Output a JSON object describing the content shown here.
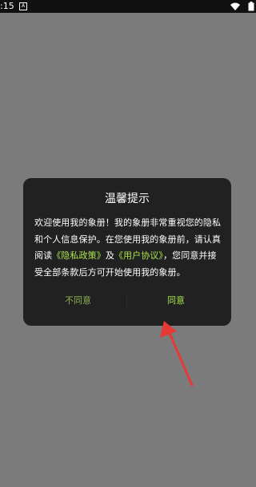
{
  "status_bar": {
    "time": ":15",
    "notification_glyph": "A",
    "icons": [
      "wifi-icon",
      "battery-icon"
    ]
  },
  "dialog": {
    "title": "温馨提示",
    "message": {
      "part1": "欢迎使用我的象册！我的象册非常重视您的隐私和个人信息保护。在您使用我的象册前，请认真阅读",
      "privacy_link": "《隐私政策》",
      "and": "及",
      "terms_link": "《用户协议》",
      "part2": "，您同意并接受全部条款后方可开始使用我的象册。"
    },
    "buttons": {
      "disagree": "不同意",
      "agree": "同意"
    }
  },
  "annotation": {
    "arrow_color": "#e53935"
  },
  "colors": {
    "backdrop": "#7b7b7b",
    "dialog_bg": "#212121",
    "accent": "#a7e34a",
    "disagree": "#8fb052"
  }
}
